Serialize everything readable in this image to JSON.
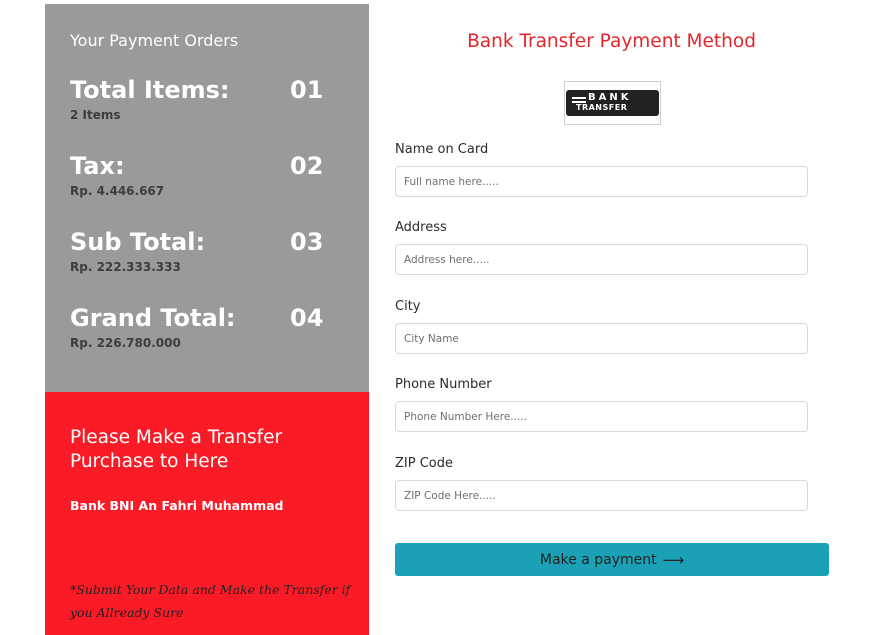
{
  "summary": {
    "title": "Your Payment Orders",
    "rows": [
      {
        "label": "Total Items:",
        "number": "01",
        "sub": "2 Items"
      },
      {
        "label": "Tax:",
        "number": "02",
        "sub": "Rp. 4.446.667"
      },
      {
        "label": "Sub Total:",
        "number": "03",
        "sub": "Rp. 222.333.333"
      },
      {
        "label": "Grand Total:",
        "number": "04",
        "sub": "Rp. 226.780.000"
      }
    ]
  },
  "transfer": {
    "heading": "Please Make a Transfer Purchase to Here",
    "bank_name": "Bank BNI An Fahri Muhammad",
    "note": "*Submit Your Data and Make the Transfer if you Allready Sure"
  },
  "form": {
    "title": "Bank Transfer Payment Method",
    "logo": {
      "line1": "BANK",
      "line2": "TRANSFER"
    },
    "fields": [
      {
        "label": "Name on Card",
        "placeholder": "Full name here.....",
        "value": ""
      },
      {
        "label": "Address",
        "placeholder": "Address here.....",
        "value": ""
      },
      {
        "label": "City",
        "placeholder": "City Name",
        "value": ""
      },
      {
        "label": "Phone Number",
        "placeholder": "Phone Number Here.....",
        "value": ""
      },
      {
        "label": "ZIP Code",
        "placeholder": "ZIP Code Here.....",
        "value": ""
      }
    ],
    "button_label": "Make a payment",
    "button_icon": "arrow-right-icon"
  },
  "colors": {
    "summary_bg": "#9a9a9a",
    "transfer_bg": "#fb1b27",
    "title_red": "#e3262c",
    "button_teal": "#1aa1b5"
  }
}
